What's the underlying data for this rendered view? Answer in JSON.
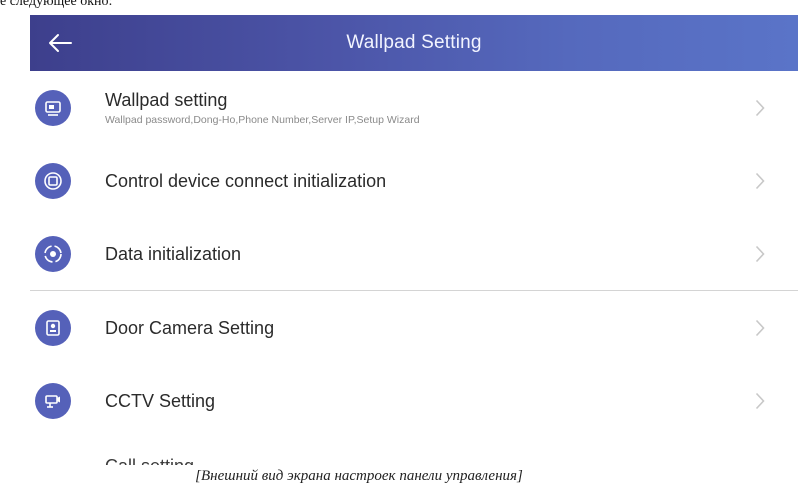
{
  "document": {
    "top_text": "е следующее окно:",
    "caption": "[Внешний вид экрана настроек панели управления]"
  },
  "header": {
    "title": "Wallpad Setting",
    "back_icon": "arrow-left-icon"
  },
  "colors": {
    "header_gradient_start": "#3d3f8c",
    "header_gradient_end": "#5a74c8",
    "icon_background": "#5561b9",
    "divider": "#d4d4d4"
  },
  "menu": {
    "items": [
      {
        "label": "Wallpad setting",
        "sublabel": "Wallpad password,Dong-Ho,Phone Number,Server IP,Setup Wizard",
        "icon": "wallpad-settings-icon"
      },
      {
        "label": "Control device connect initialization",
        "icon": "device-connect-icon"
      },
      {
        "label": "Data initialization",
        "icon": "data-reset-icon"
      },
      {
        "label": "Door Camera Setting",
        "icon": "door-camera-icon"
      },
      {
        "label": "CCTV Setting",
        "icon": "cctv-icon"
      },
      {
        "label": "Call setting",
        "icon": "call-icon"
      }
    ]
  }
}
